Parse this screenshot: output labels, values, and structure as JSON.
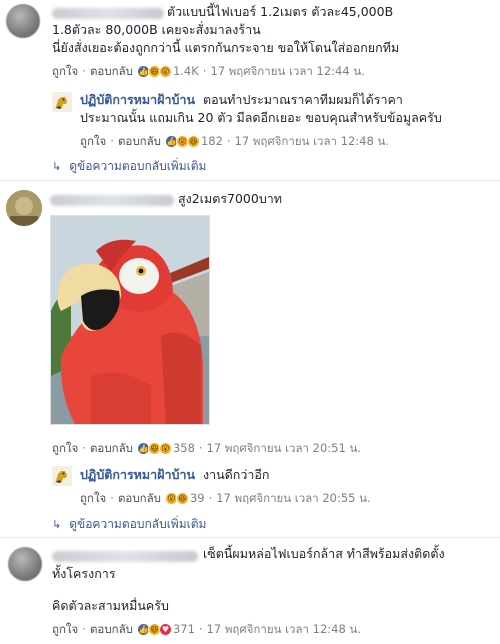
{
  "comments": [
    {
      "line1": "ตัวแบบนี้ไฟเบอร์ 1.2เมตร ตัวละ45,000B",
      "line2": "1.8ตัวละ 80,000B เคยจะสั่งมาลงร้าน",
      "line3": "นี่ยังสั่งเยอะต้องถูกกว่านี้ แตรกกันกระจาย ขอให้โดนใส่ออกยกทีม",
      "like": "ถูกใจ",
      "reply": "ตอบกลับ",
      "count": "1.4K",
      "time": "17 พฤศจิกายน เวลา 12:44 น.",
      "page_reply": {
        "name": "ปฏิบัติการหมาฝ้าบ้าน",
        "line1": "ตอนทำประมาณราคาทีมผมก็ได้ราคา",
        "line2": "ประมาณนั้น แถมเกิน 20 ตัว มีลดอีกเยอะ ขอบคุณสำหรับข้อมูลครับ",
        "like": "ถูกใจ",
        "reply": "ตอบกลับ",
        "count": "182",
        "time": "17 พฤศจิกายน เวลา 12:48 น."
      },
      "more": "ดูข้อความตอบกลับเพิ่มเติม"
    },
    {
      "line1": "สูง2เมตร7000บาท",
      "like": "ถูกใจ",
      "reply": "ตอบกลับ",
      "count": "358",
      "time": "17 พฤศจิกายน เวลา 20:51 น.",
      "page_reply": {
        "name": "ปฏิบัติการหมาฝ้าบ้าน",
        "line1": "งานดีกว่าอีก",
        "like": "ถูกใจ",
        "reply": "ตอบกลับ",
        "count": "39",
        "time": "17 พฤศจิกายน เวลา 20:55 น."
      },
      "more": "ดูข้อความตอบกลับเพิ่มเติม"
    },
    {
      "line1": "เซ็ตนี้ผมหล่อไฟเบอร์กล้าส ทำสีพร้อมส่งติดตั้ง",
      "line2": "ทั้งโครงการ",
      "line3": "คิดตัวละสามหมื่นครับ",
      "like": "ถูกใจ",
      "reply": "ตอบกลับ",
      "count": "371",
      "time": "17 พฤศจิกายน เวลา 12:48 น."
    }
  ],
  "separator": "·",
  "colors": {
    "link": "#365899",
    "meta": "#7f7f7f",
    "like": "#4267b2",
    "haha": "#f7b125",
    "love": "#f0284a"
  }
}
